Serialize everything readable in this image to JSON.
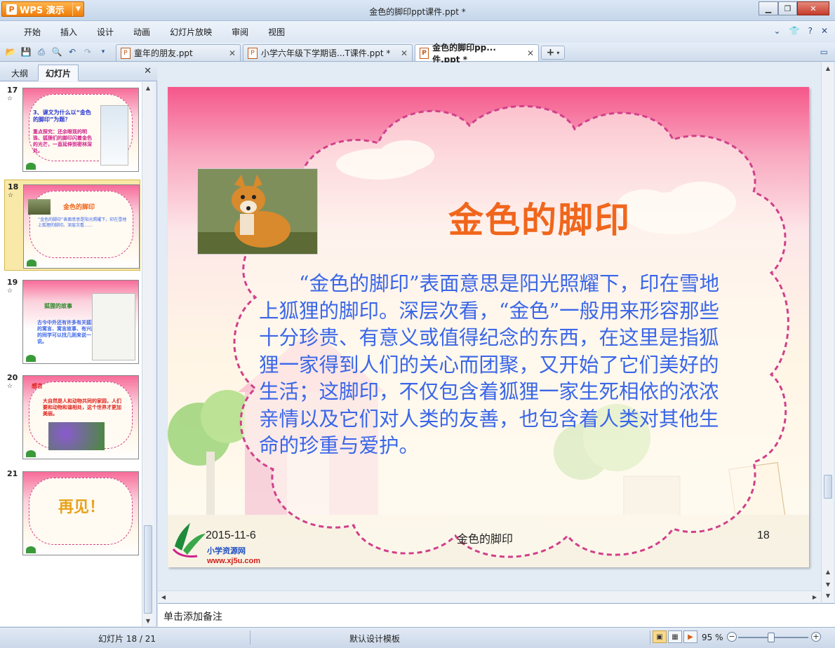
{
  "app": {
    "menu_label": "WPS 演示",
    "window_title": "金色的脚印ppt课件.ppt *"
  },
  "menu": {
    "items": [
      "开始",
      "插入",
      "设计",
      "动画",
      "幻灯片放映",
      "审阅",
      "视图"
    ]
  },
  "doc_tabs": [
    {
      "label": "童年的朋友.ppt",
      "active": false
    },
    {
      "label": "小学六年级下学期语...T课件.ppt *",
      "active": false
    },
    {
      "label": "金色的脚印pp...件.ppt *",
      "active": true
    }
  ],
  "left_panel": {
    "tabs": [
      "大纲",
      "幻灯片"
    ],
    "active_tab": "幻灯片",
    "slides": [
      {
        "number": "17",
        "star": "☆",
        "title": "3、课文为什么以“金色的脚印”为题？",
        "text": "重点探究：还余眼现的明珠、狐狸们的脚印闪着金色的光芒，一直延伸到密林深处。",
        "selected": false
      },
      {
        "number": "18",
        "star": "☆",
        "title": "金色的脚印",
        "text": "“金色的脚印”表面意思是阳光照耀下，印在雪地上狐狸的脚印。深层次看……",
        "selected": true
      },
      {
        "number": "19",
        "star": "☆",
        "title": "狐狸的故事",
        "text": "古今中外还有许多有关狐狸的寓言、寓言故事、有兴趣的同学可以找几则来说一说。",
        "selected": false
      },
      {
        "number": "20",
        "star": "☆",
        "title": "感言",
        "text": "大自然是人和动物共同的家园，人们要和动物和谐相处，这个世界才更加美丽。",
        "selected": false
      },
      {
        "number": "21",
        "star": "",
        "title": "再见！",
        "text": "",
        "selected": false
      }
    ]
  },
  "slide": {
    "title": "金色的脚印",
    "body": "“金色的脚印”表面意思是阳光照耀下，印在雪地上狐狸的脚印。深层次看，“金色”一般用来形容那些十分珍贵、有意义或值得纪念的东西，在这里是指狐狸一家得到人们的关心而团聚，又开始了它们美好的生活；这脚印，不仅包含着狐狸一家生死相依的浓浓亲情以及它们对人类的友善，也包含着人类对其他生命的珍重与爱护。",
    "footer_date": "2015-11-6",
    "footer_center": "金色的脚印",
    "footer_page": "18",
    "site_logo_text": "小学资源网",
    "site_url": "www.xj5u.com"
  },
  "notes": {
    "placeholder": "单击添加备注"
  },
  "status": {
    "slide_info": "幻灯片 18 / 21",
    "template": "默认设计模板",
    "zoom": "95 %",
    "zoom_value": 95
  },
  "colors": {
    "title_orange": "#f0661c",
    "body_blue": "#3a66e8",
    "accent_pink": "#d0408a",
    "wps_orange": "#ee7d0b"
  }
}
